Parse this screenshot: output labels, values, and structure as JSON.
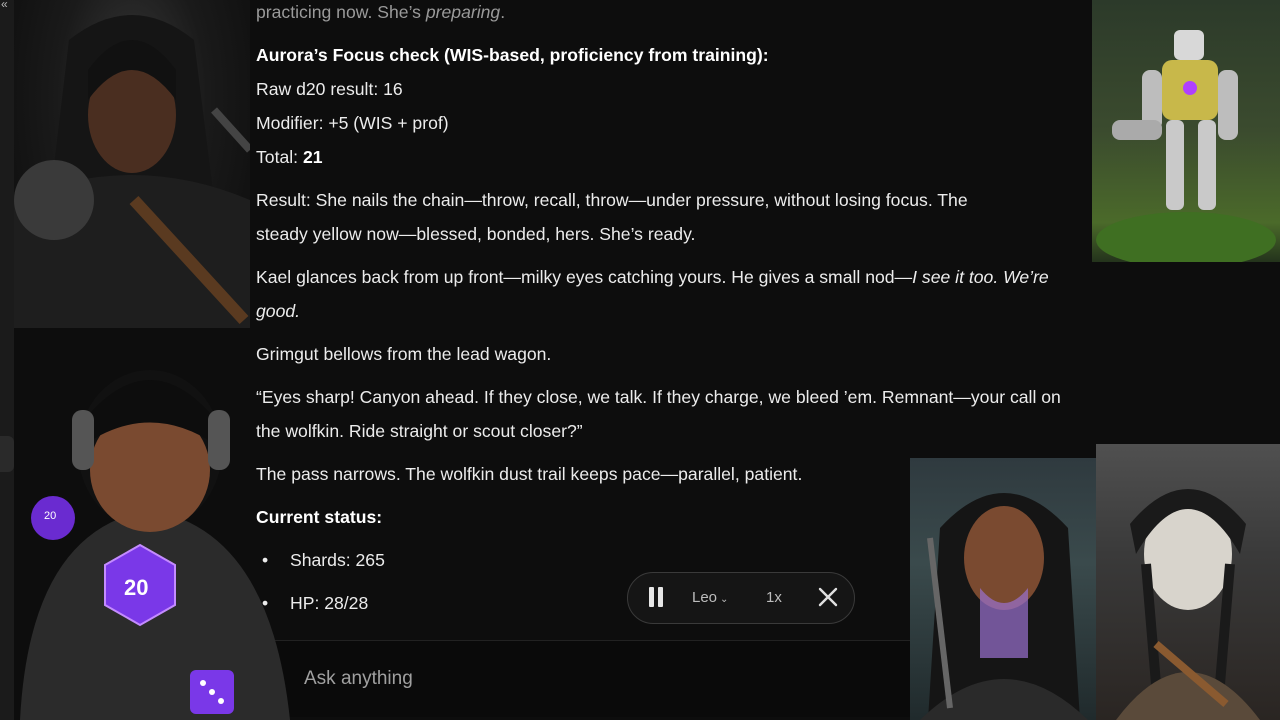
{
  "message": {
    "line_top_plain": "practicing now. She’s ",
    "line_top_italic": "preparing",
    "line_top_end": ".",
    "check_heading": "Aurora’s Focus check (WIS-based, proficiency from training):",
    "raw_roll": "Raw d20 result: 16",
    "modifier": "Modifier: +5 (WIS + prof)",
    "total_label": "Total: ",
    "total_value": "21",
    "result_p1": "Result: She nails the chain—throw, recall, throw—under pressure, without losing focus. The",
    "result_p2": "steady yellow now—blessed, bonded, hers. She’s ready.",
    "kael_plain": "Kael glances back from up front—milky eyes catching yours. He gives a small nod—",
    "kael_italic1": "I see it too. We’re",
    "kael_italic2": "good.",
    "grimgut": "Grimgut bellows from the lead wagon.",
    "quote_p1": "“Eyes sharp! Canyon ahead. If they close, we talk. If they charge, we bleed ’em. Remnant—your call on",
    "quote_p2": "the wolfkin. Ride straight or scout closer?”",
    "pass": "The pass narrows. The wolfkin dust trail keeps pace—parallel, patient.",
    "status_heading": "Current status:",
    "status_items": [
      "Shards: 265",
      "HP: 28/28"
    ]
  },
  "player": {
    "voice": "Leo",
    "speed": "1x"
  },
  "composer": {
    "placeholder": "Ask anything"
  },
  "mascot": {
    "die_small": "20",
    "die_big": "20"
  },
  "colors": {
    "background": "#0d0d0d",
    "text": "#ececec",
    "accent_purple": "#8a3cff"
  }
}
